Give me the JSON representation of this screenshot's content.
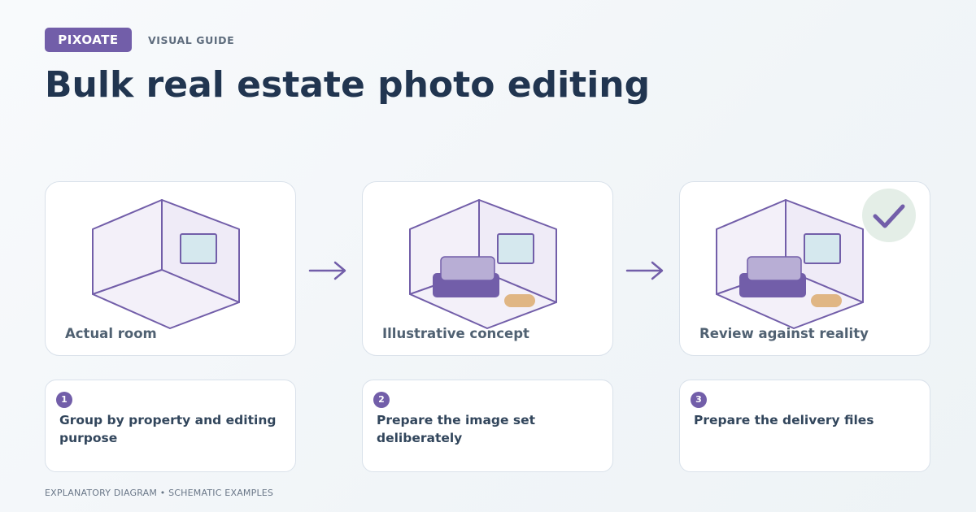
{
  "header": {
    "brand": "PIXOATE",
    "guide_label": "VISUAL GUIDE",
    "title": "Bulk real estate photo editing"
  },
  "panels": [
    {
      "label": "Actual room",
      "icon": "empty-room-icon"
    },
    {
      "label": "Illustrative concept",
      "icon": "furnished-room-icon"
    },
    {
      "label": "Review against reality",
      "icon": "furnished-room-icon",
      "badge_icon": "checkmark-icon"
    }
  ],
  "steps": [
    {
      "number": "1",
      "text": "Group by property and editing purpose"
    },
    {
      "number": "2",
      "text": "Prepare the image set deliberately"
    },
    {
      "number": "3",
      "text": "Prepare the delivery files"
    }
  ],
  "footer": {
    "note": "EXPLANATORY DIAGRAM • SCHEMATIC EXAMPLES"
  },
  "colors": {
    "accent": "#725ea9",
    "sofa_back": "#b8aed5",
    "rug": "#e0b684",
    "window": "#d5e8ee",
    "room_fill": "#efebf7",
    "check_bg": "#e4eee7",
    "title": "#213550"
  }
}
